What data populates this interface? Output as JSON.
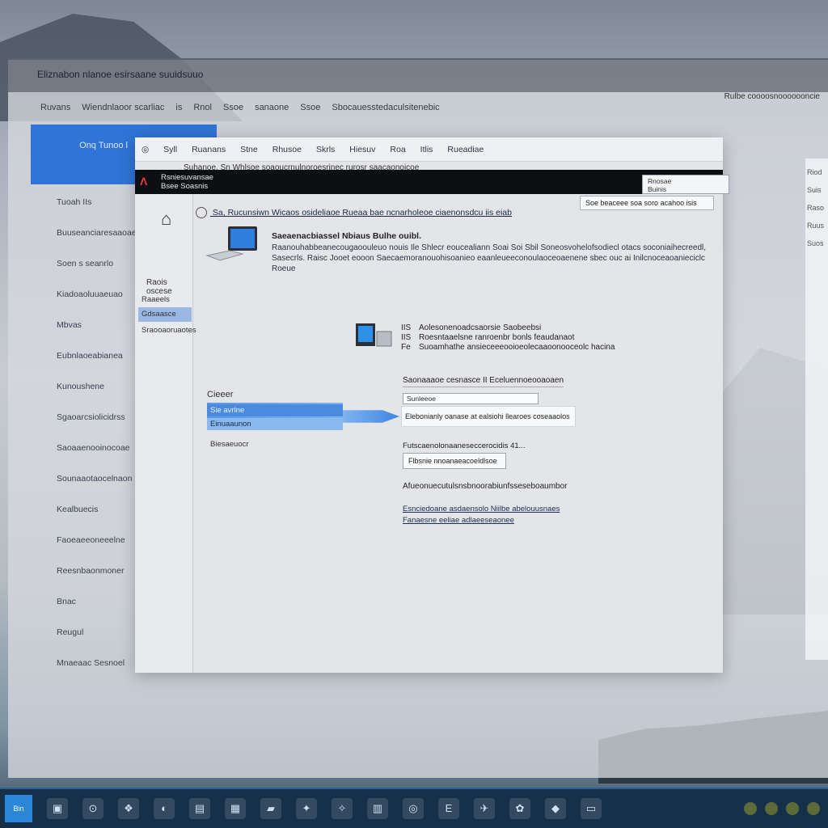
{
  "back_window": {
    "title": "Eliznabon nlanoe esirsaane suuidsuuo",
    "title_right": "Rulbe coooosnooooooncie",
    "toolbar": [
      "Ruvans",
      "Wiendnlaoor scarliac",
      "is",
      "Rnol",
      "Ssoe",
      "sanaone",
      "Ssoe",
      "Sbocauesstedaculsitenebic"
    ],
    "blue_tile": "Onq Tunoo l",
    "nav": [
      "Tuoah IIs",
      "Buuseanciaresaaoae",
      "Soen s seanrlo",
      "Kiadoaoluuaeuao",
      "Mbvas",
      "Eubnlaoeabianea",
      "Kunoushene",
      "Sgaoarcsiolicidrss",
      "Saoaaenooinocoae",
      "Sounaaotaocelnaon",
      "Kealbuecis",
      "Faoeaeeoneeelne",
      "Reesnbaonmoner",
      "Bnac",
      "Reugul",
      "Mnaeaac Sesnoel"
    ],
    "right_panel": [
      "Riod",
      "Suis",
      "Raso",
      "Ruus",
      "Suos"
    ]
  },
  "dialog": {
    "titlebar": [
      "Syll",
      "Ruanans",
      "Stne",
      "Rhusoe",
      "Skrls",
      "Hiesuv",
      "Roa",
      "Itlis",
      "Rueadiae"
    ],
    "subbar": "Suhanoe, Sn   Whlsoe soaoucrnulnoroesrinec rurosr saacaonoicoe",
    "header_text": [
      "Rsniesuvansae",
      "Bsee Soasnis"
    ],
    "search": [
      "Rnosae",
      "Buinis"
    ],
    "sidebar": {
      "heading": "Raois oscese",
      "items": [
        "Raaeels",
        "Gdsaasce",
        "Sraooaoruaotes"
      ]
    },
    "breadcrumb": "Sa, Rucunsiwn Wicaos osideliaoe Rueaa bae ncnarholeoe ciaenonsdcu iis eiab",
    "dropdown": "Soe beaceee soa soro acahoo isis",
    "info": {
      "title": "Saeaenacbiassel Nbiaus Bulhe ouibl.",
      "description": "Raanouhabbeanecougaoouleuo nouis Ile Shlecr eoucealiann Soai Soi Sbil Soneosvohelofsodiecl otacs soconiaihecreedl, Sasecrls. Raisc Jooet eooon Saecaemoranouohisoanieo eaanleueeconoulaoceoaenene sbec ouc ai Inilcnoceaoanieciclc Roeue"
    },
    "specs": [
      {
        "k": "IIS",
        "v": "Aolesonenoadcsaorsie Saobeebsi"
      },
      {
        "k": "IIS",
        "v": "Roesntaaelsne ranroenbr bonls feaudanaot"
      },
      {
        "k": "Fe",
        "v": "Suoamhathe ansieceeeooioeolecaaoonooceolc hacina"
      }
    ],
    "section_label": "Cieeer",
    "list": [
      "Sie avrlne",
      "Einuaaunon",
      "Biesaeuocr"
    ],
    "form": {
      "title": "Saonaaaoe cesnasce II Eceluennoeooaoaen",
      "input": "Sunleeoe",
      "highlight": "Elebonianly oanase at ealsiohi llearoes coseaaolos",
      "label2": "Futscaenolonaaneseccerocidis 41...",
      "button": "Flbsnie nnoanaeacoeldlsoe",
      "heading": "Afueonuecutulsnsbnoorabiunfsseseboaumbor",
      "links": [
        "Esnciedoane asdaensolo Niilbe abelouusnaes",
        "Fanaesne eeliae adlaeeseaonee"
      ]
    }
  },
  "taskbar": {
    "start": "Bin",
    "items": [
      "▣",
      "⊙",
      "❖",
      "◐",
      "▤",
      "▦",
      "▰",
      "✦",
      "✧",
      "▥",
      "◎",
      "E",
      "✈",
      "✿",
      "◆",
      "▭"
    ]
  },
  "colors": {
    "accent": "#2f74d6",
    "selected": "#4a8be0",
    "header": "#0e0f12",
    "taskbar": "#16304a"
  }
}
